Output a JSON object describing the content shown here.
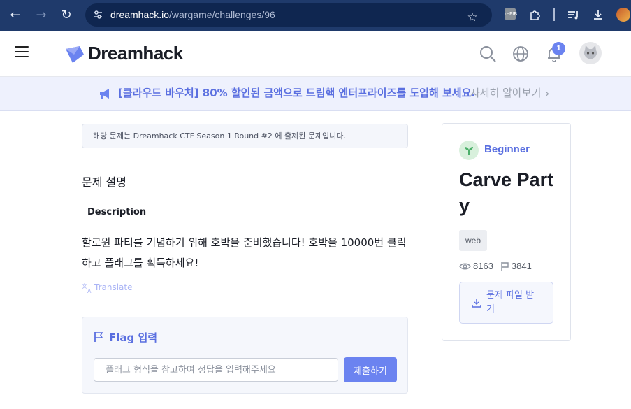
{
  "browser": {
    "url_host": "dreamhack.io",
    "url_path": "/wargame/challenges/96",
    "extension_badge": "rePIB"
  },
  "header": {
    "logo_text": "Dreamhack",
    "notification_count": "1"
  },
  "banner": {
    "text": "[클라우드 바우처] 80% 할인된 금액으로 드림핵 엔터프라이즈를 도입해 보세요.",
    "link": "자세히 알아보기"
  },
  "main": {
    "notice": "해당 문제는 Dreamhack CTF Season 1 Round #2 에 출제된 문제입니다.",
    "section_title": "문제 설명",
    "description_heading": "Description",
    "description_text": "할로윈 파티를 기념하기 위해 호박을 준비했습니다! 호박을 10000번 클릭하고 플래그를 획득하세요!",
    "translate_label": "Translate"
  },
  "flag": {
    "title": "Flag 입력",
    "placeholder": "플래그 형식을 참고하여 정답을 입력해주세요",
    "value": "",
    "submit_label": "제출하기"
  },
  "challenge": {
    "level": "Beginner",
    "title": "Carve Party",
    "tag": "web",
    "views": "8163",
    "solves": "3841",
    "download_label": "문제 파일 받기"
  },
  "colors": {
    "accent": "#6b83f0",
    "chrome": "#1f3a6b",
    "banner_bg": "#eef1fd"
  }
}
